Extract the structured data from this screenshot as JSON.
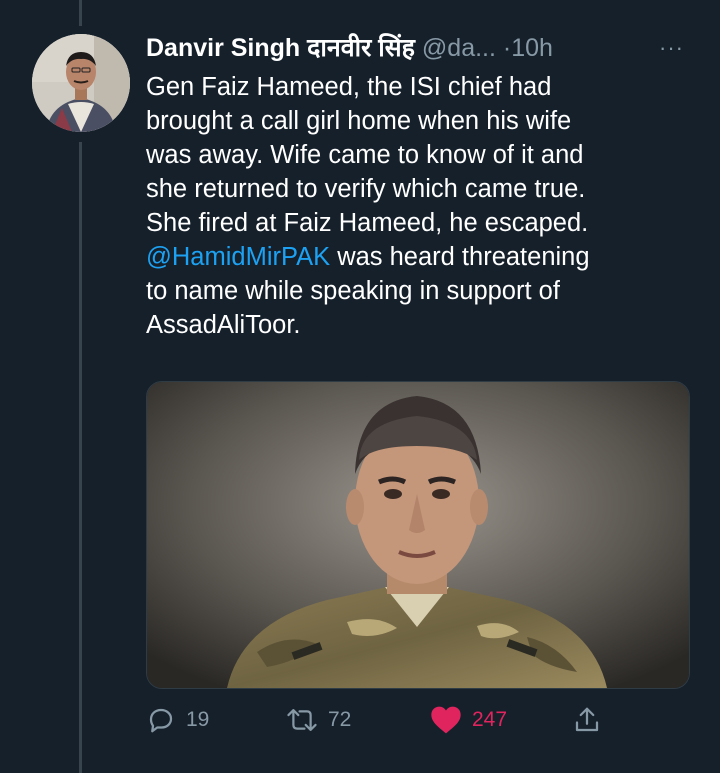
{
  "tweet": {
    "display_name": "Danvir Singh दानवीर सिंह",
    "handle": "@da...",
    "separator": " ·",
    "time": "10h",
    "more_label": "···",
    "text_lines": [
      "Gen Faiz Hameed, the ISI chief had",
      "brought a call girl home when his wife",
      "was away. Wife came to know of it and",
      "she returned to verify which came true.",
      "She fired at Faiz Hameed, he escaped."
    ],
    "mention": "@HamidMirPAK",
    "line6_rest": " was heard threatening",
    "text_lines_end": [
      "to name while speaking in support of",
      "AssadAliToor."
    ]
  },
  "actions": {
    "replies": "19",
    "retweets": "72",
    "likes": "247"
  },
  "icons": {
    "reply": "reply-icon",
    "retweet": "retweet-icon",
    "like": "heart-icon",
    "share": "share-icon",
    "more": "more-icon"
  },
  "colors": {
    "background": "#15202b",
    "secondary_text": "#8899a6",
    "link": "#1da1f2",
    "like": "#e0245e"
  }
}
